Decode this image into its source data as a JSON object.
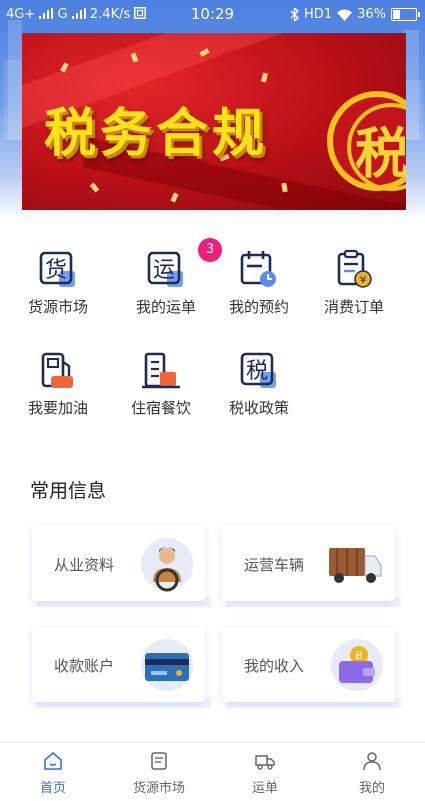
{
  "status_bar": {
    "network_left": "4G+",
    "carrier": "G",
    "speed": "2.4K/s",
    "time": "10:29",
    "hd_indicator": "HD1",
    "battery": "36%",
    "battery_level": 0.36,
    "icons": [
      "signal-icon",
      "signal-icon",
      "nfc-icon",
      "bluetooth-icon",
      "wifi-icon",
      "battery-icon"
    ]
  },
  "banner": {
    "title": "税务合规",
    "emblem_char": "税"
  },
  "quick_menu": {
    "items": [
      {
        "label": "货源市场",
        "icon": "cargo-source-icon"
      },
      {
        "label": "我的运单",
        "icon": "waybill-icon",
        "badge": "3"
      },
      {
        "label": "我的预约",
        "icon": "calendar-icon"
      },
      {
        "label": "消费订单",
        "icon": "order-icon"
      },
      {
        "label": "我要加油",
        "icon": "fuel-pump-icon"
      },
      {
        "label": "住宿餐饮",
        "icon": "hotel-dining-icon"
      },
      {
        "label": "税收政策",
        "icon": "tax-policy-icon"
      }
    ]
  },
  "common_info": {
    "title": "常用信息",
    "cards": [
      {
        "label": "从业资料",
        "icon": "driver-avatar-icon"
      },
      {
        "label": "运营车辆",
        "icon": "truck-icon"
      },
      {
        "label": "收款账户",
        "icon": "bank-card-icon"
      },
      {
        "label": "我的收入",
        "icon": "wallet-coin-icon"
      }
    ]
  },
  "tabbar": {
    "tabs": [
      {
        "label": "首页",
        "icon": "home-icon",
        "active": true
      },
      {
        "label": "货源市场",
        "icon": "document-icon",
        "active": false
      },
      {
        "label": "运单",
        "icon": "truck-icon",
        "active": false
      },
      {
        "label": "我的",
        "icon": "user-icon",
        "active": false
      }
    ]
  },
  "colors": {
    "accent": "#3b6fe0",
    "icon_navy": "#1e2a5a",
    "icon_blue": "#5b8def",
    "icon_orange": "#f0663b",
    "badge": "#ef1f7a",
    "banner_red": "#c4141b",
    "banner_gold": "#ffe21a"
  }
}
